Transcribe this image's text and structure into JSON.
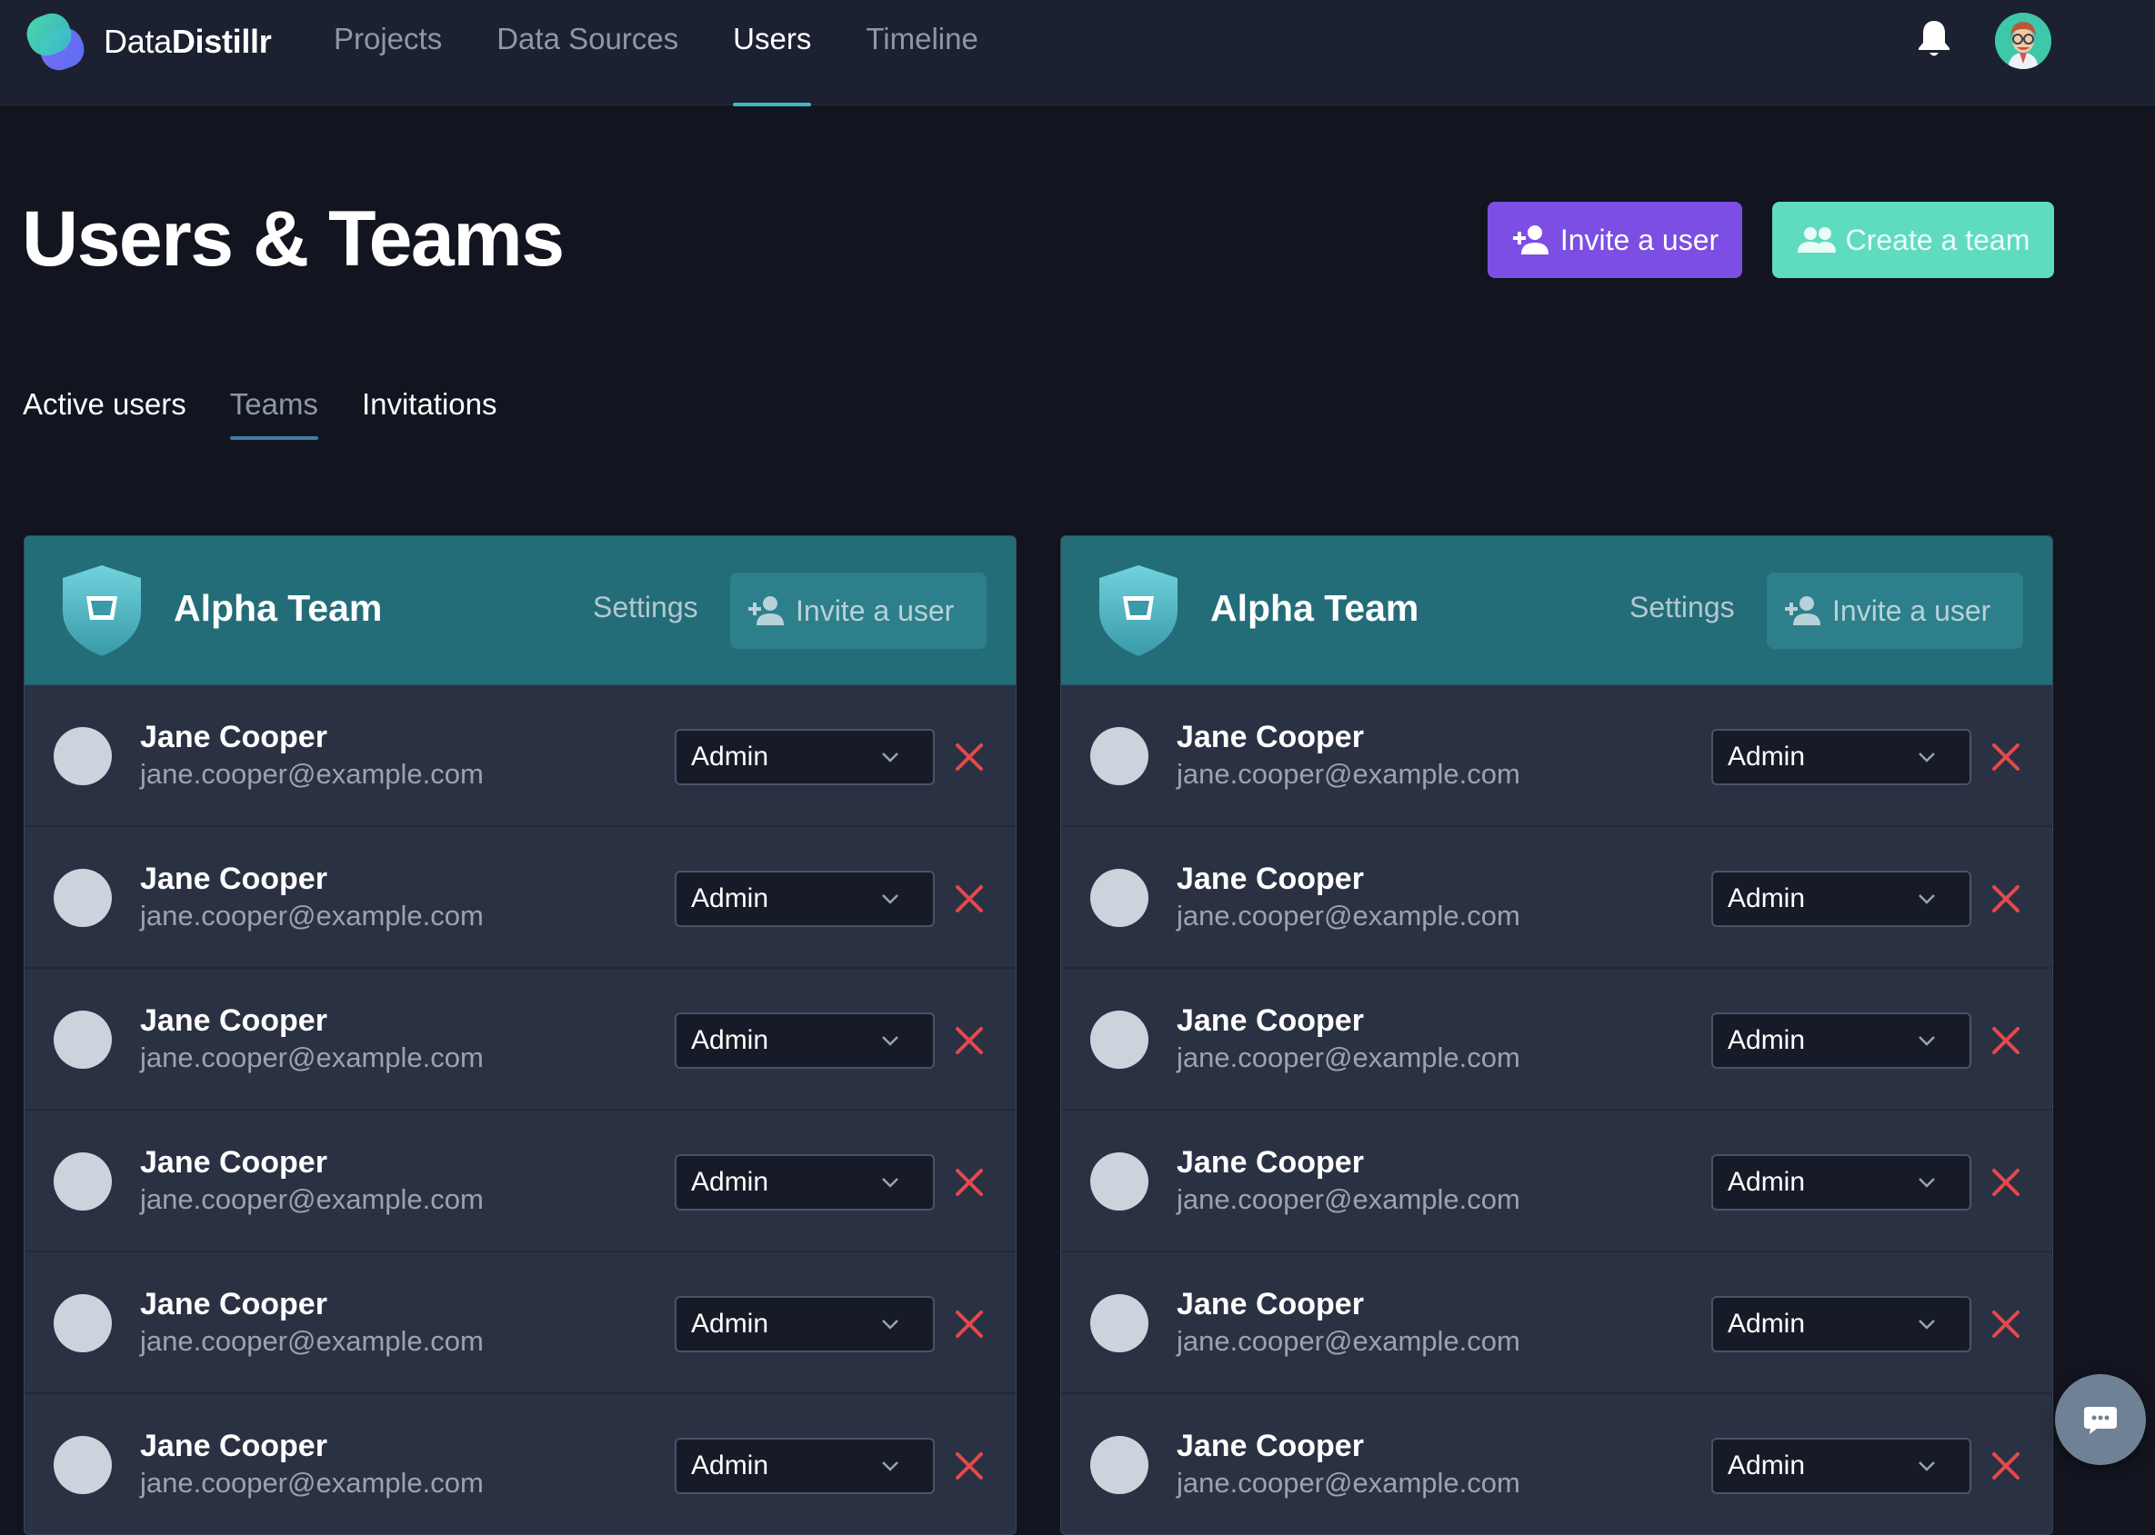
{
  "app": {
    "name_light": "Data",
    "name_bold": "Distillr"
  },
  "nav": {
    "items": [
      {
        "label": "Projects",
        "active": false
      },
      {
        "label": "Data Sources",
        "active": false
      },
      {
        "label": "Users",
        "active": true
      },
      {
        "label": "Timeline",
        "active": false
      }
    ],
    "icons": [
      "bell-icon",
      "avatar"
    ]
  },
  "page": {
    "title": "Users & Teams",
    "invite_user_label": "Invite a user",
    "create_team_label": "Create a team"
  },
  "tabs": [
    {
      "label": "Active users",
      "active": false
    },
    {
      "label": "Teams",
      "active": true
    },
    {
      "label": "Invitations",
      "active": false
    }
  ],
  "teams": [
    {
      "name": "Alpha Team",
      "settings_label": "Settings",
      "invite_label": "Invite a user",
      "members": [
        {
          "name": "Jane Cooper",
          "email": "jane.cooper@example.com",
          "role": "Admin"
        },
        {
          "name": "Jane Cooper",
          "email": "jane.cooper@example.com",
          "role": "Admin"
        },
        {
          "name": "Jane Cooper",
          "email": "jane.cooper@example.com",
          "role": "Admin"
        },
        {
          "name": "Jane Cooper",
          "email": "jane.cooper@example.com",
          "role": "Admin"
        },
        {
          "name": "Jane Cooper",
          "email": "jane.cooper@example.com",
          "role": "Admin"
        },
        {
          "name": "Jane Cooper",
          "email": "jane.cooper@example.com",
          "role": "Admin"
        }
      ]
    },
    {
      "name": "Alpha Team",
      "settings_label": "Settings",
      "invite_label": "Invite a user",
      "members": [
        {
          "name": "Jane Cooper",
          "email": "jane.cooper@example.com",
          "role": "Admin"
        },
        {
          "name": "Jane Cooper",
          "email": "jane.cooper@example.com",
          "role": "Admin"
        },
        {
          "name": "Jane Cooper",
          "email": "jane.cooper@example.com",
          "role": "Admin"
        },
        {
          "name": "Jane Cooper",
          "email": "jane.cooper@example.com",
          "role": "Admin"
        },
        {
          "name": "Jane Cooper",
          "email": "jane.cooper@example.com",
          "role": "Admin"
        },
        {
          "name": "Jane Cooper",
          "email": "jane.cooper@example.com",
          "role": "Admin"
        }
      ]
    }
  ],
  "colors": {
    "background": "#12151f",
    "nav_background": "#1b2130",
    "accent_purple": "#7c4ee4",
    "accent_mint": "#5fdcbf",
    "team_header": "#236d79",
    "remove_red": "#e5484d"
  }
}
